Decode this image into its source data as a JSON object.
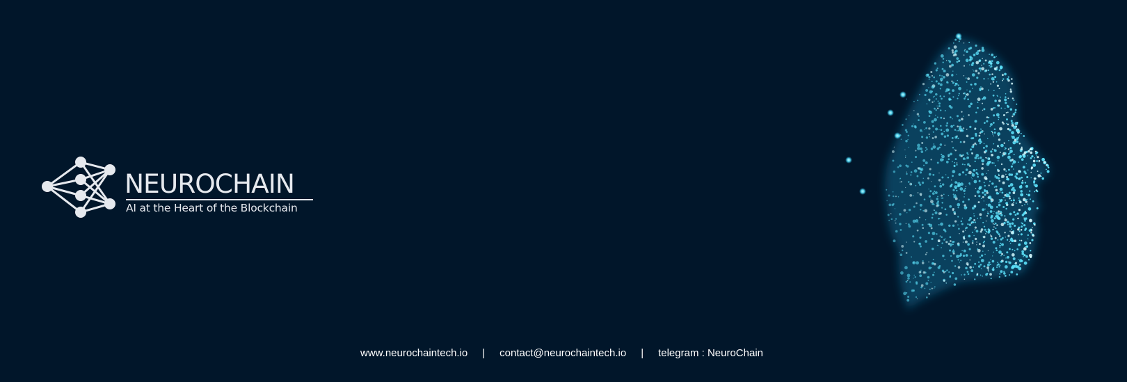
{
  "brand": {
    "name": "NEUROCHAIN",
    "tagline": "AI at the Heart of the Blockchain"
  },
  "contact": {
    "website": "www.neurochaintech.io",
    "separator": "|",
    "email": "contact@neurochaintech.io",
    "telegram": "telegram : NeuroChain"
  },
  "icons": {
    "logo": "neural-network-logo-icon",
    "hero": "particle-face-illustration"
  },
  "colors": {
    "background": "#01162a",
    "text": "#e6e9ee",
    "particle": "#5fe6ff",
    "particle_glow": "#1fb4e6"
  }
}
